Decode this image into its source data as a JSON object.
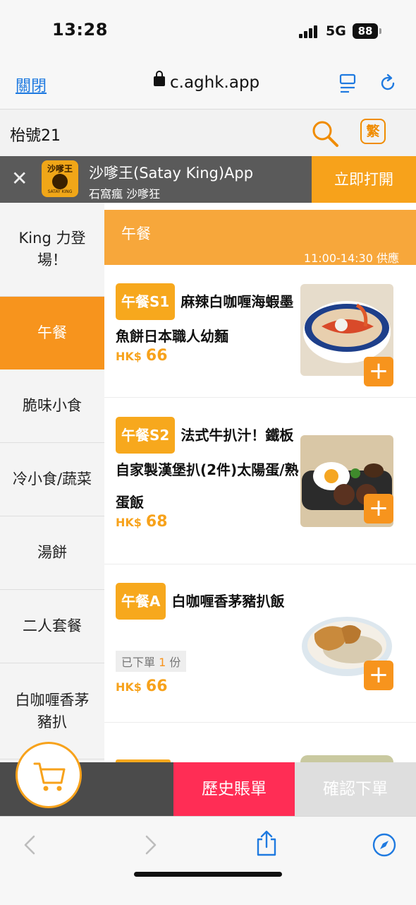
{
  "status_bar": {
    "time": "13:28",
    "network": "5G",
    "battery": "88"
  },
  "browser": {
    "close_label": "關閉",
    "url": "c.aghk.app"
  },
  "store": {
    "name": "枱號21",
    "lang_label": "繁"
  },
  "app_banner": {
    "logo_text": "沙嗲王",
    "logo_sub": "SATAY KING",
    "title": "沙嗲王(Satay King)App",
    "subtitle": "石窩瘋 沙嗲狂",
    "open_label": "立即打開"
  },
  "categories": [
    {
      "label": "King 力登場！"
    },
    {
      "label": "午餐",
      "active": true
    },
    {
      "label": "脆味小食"
    },
    {
      "label": "冷小食/蔬菜"
    },
    {
      "label": "湯餅"
    },
    {
      "label": "二人套餐"
    },
    {
      "label": "白咖喱香茅豬扒"
    }
  ],
  "section": {
    "title": "午餐",
    "hours": "11:00-14:30 供應"
  },
  "menu_items": [
    {
      "code": "午餐S1",
      "name": "麻辣白咖喱海蝦墨魚餅日本職人幼麵",
      "currency": "HK$",
      "price": "66"
    },
    {
      "code": "午餐S2",
      "name": "法式牛扒汁！鐵板自家製漢堡扒(2件)太陽蛋/熟蛋飯",
      "currency": "HK$",
      "price": "68"
    },
    {
      "code": "午餐A",
      "name": "白咖喱香茅豬扒飯",
      "currency": "HK$",
      "price": "66",
      "ordered_prefix": "已下單",
      "ordered_count": "1",
      "ordered_suffix": "份"
    }
  ],
  "action_bar": {
    "history_label": "歷史賬單",
    "confirm_label": "確認下單"
  },
  "colors": {
    "accent": "#f7941d",
    "history": "#ff2d55",
    "banner": "#5a5a5a"
  }
}
